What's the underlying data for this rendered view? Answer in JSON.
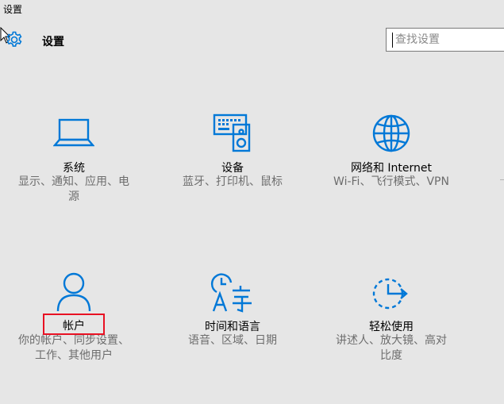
{
  "window": {
    "title": "设置"
  },
  "header": {
    "title": "设置",
    "icon": "gear-icon",
    "search_placeholder": "查找设置",
    "search_value": ""
  },
  "colors": {
    "accent": "#0078d7",
    "background": "#e6e6e6",
    "highlight": "#e81123",
    "description": "#6d6d6d"
  },
  "tiles": [
    {
      "id": "system",
      "icon": "laptop-icon",
      "label": "系统",
      "desc_lines": [
        "显示、通知、应用、电",
        "源"
      ]
    },
    {
      "id": "devices",
      "icon": "keyboard-speaker-icon",
      "label": "设备",
      "desc_lines": [
        "蓝牙、打印机、鼠标"
      ]
    },
    {
      "id": "network",
      "icon": "globe-icon",
      "label": "网络和 Internet",
      "desc_lines": [
        "Wi-Fi、飞行模式、VPN"
      ]
    },
    {
      "id": "accounts",
      "icon": "person-icon",
      "label": "帐户",
      "desc_lines": [
        "你的帐户、同步设置、",
        "工作、其他用户"
      ]
    },
    {
      "id": "time-language",
      "icon": "time-language-icon",
      "label": "时间和语言",
      "desc_lines": [
        "语音、区域、日期"
      ]
    },
    {
      "id": "ease-of-access",
      "icon": "ease-of-access-icon",
      "label": "轻松使用",
      "desc_lines": [
        "讲述人、放大镜、高对",
        "比度"
      ]
    }
  ]
}
